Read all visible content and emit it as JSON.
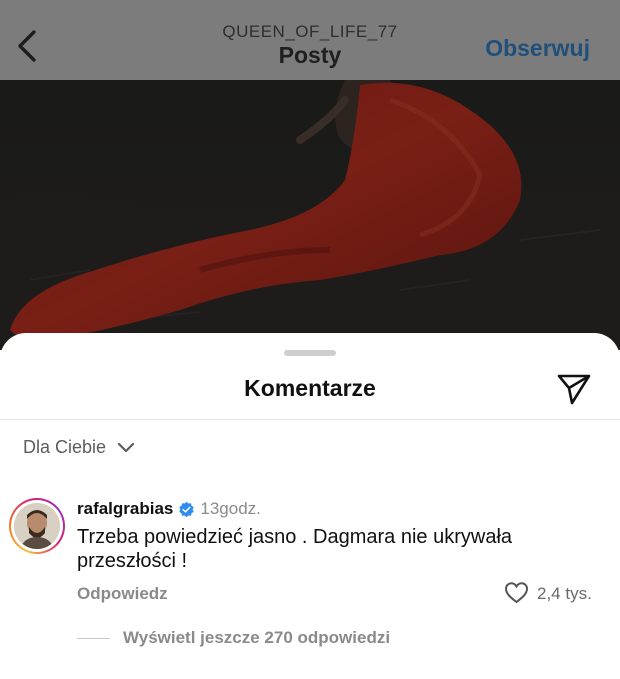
{
  "header": {
    "username": "QUEEN_OF_LIFE_77",
    "title": "Posty",
    "follow_label": "Obserwuj"
  },
  "comments_sheet": {
    "title": "Komentarze",
    "sort_label": "Dla Ciebie",
    "comment": {
      "author": "rafalgrabias",
      "time": "13godz.",
      "text": "Trzeba powiedzieć jasno . Dagmara nie ukrywała przeszłości !",
      "reply_label": "Odpowiedz",
      "like_count": "2,4 tys.",
      "view_replies_label": "Wyświetl jeszcze 270 odpowiedzi"
    }
  },
  "icons": {
    "back": "chevron-left-icon",
    "send": "paper-plane-icon",
    "sort": "chevron-down-icon",
    "verified": "verified-badge-icon",
    "like": "heart-icon"
  },
  "colors": {
    "follow_link": "#1f4f7a",
    "verified_badge": "#2f8cf0",
    "dress": "#c43323"
  }
}
